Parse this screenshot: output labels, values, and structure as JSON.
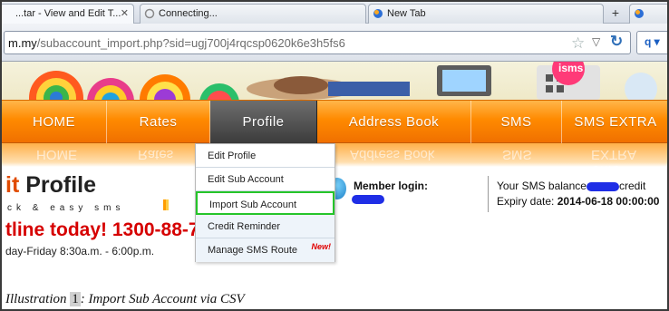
{
  "browser": {
    "tabs": [
      {
        "label": "...tar - View and Edit T...",
        "active": true
      },
      {
        "label": "Connecting...",
        "active": false
      },
      {
        "label": "New Tab",
        "active": false
      }
    ],
    "new_tab_label": "+",
    "url_host": "m.my",
    "url_path": "/subaccount_import.php?sid=ugj700j4rqcsp0620k6e3h5fs6"
  },
  "banner": {
    "badge_text": "isms"
  },
  "nav": {
    "items": [
      {
        "label": "HOME"
      },
      {
        "label": "Rates"
      },
      {
        "label": "Profile",
        "active": true
      },
      {
        "label": "Address Book"
      },
      {
        "label": "SMS"
      },
      {
        "label": "SMS EXTRA"
      }
    ]
  },
  "page": {
    "title_accent": "it",
    "title_rest": "Profile",
    "tagline": "ck & easy sms",
    "hotline": "tline today! 1300-88-7",
    "hours": "day-Friday 8:30a.m. - 6:00p.m."
  },
  "account": {
    "member_login_label": "Member login:",
    "balance_prefix": "Your SMS balance",
    "balance_suffix": "credit",
    "expiry_label": "Expiry date:",
    "expiry_value": "2014-06-18 00:00:00"
  },
  "menu": {
    "items": [
      {
        "label": "Edit Profile"
      },
      {
        "label": "Edit Sub Account"
      },
      {
        "label": "Import Sub Account",
        "highlighted": true
      },
      {
        "label": "Credit Reminder"
      },
      {
        "label": "Manage SMS Route",
        "badge": "New!"
      }
    ]
  },
  "caption": {
    "prefix": "Illustration",
    "number": "1",
    "text": ": Import Sub Account via CSV"
  },
  "colors": {
    "nav_orange": "#ff8a00",
    "nav_active": "#3a3a3a",
    "hotline_red": "#d60000",
    "highlight_green": "#25c52a",
    "title_accent": "#e04b00"
  }
}
